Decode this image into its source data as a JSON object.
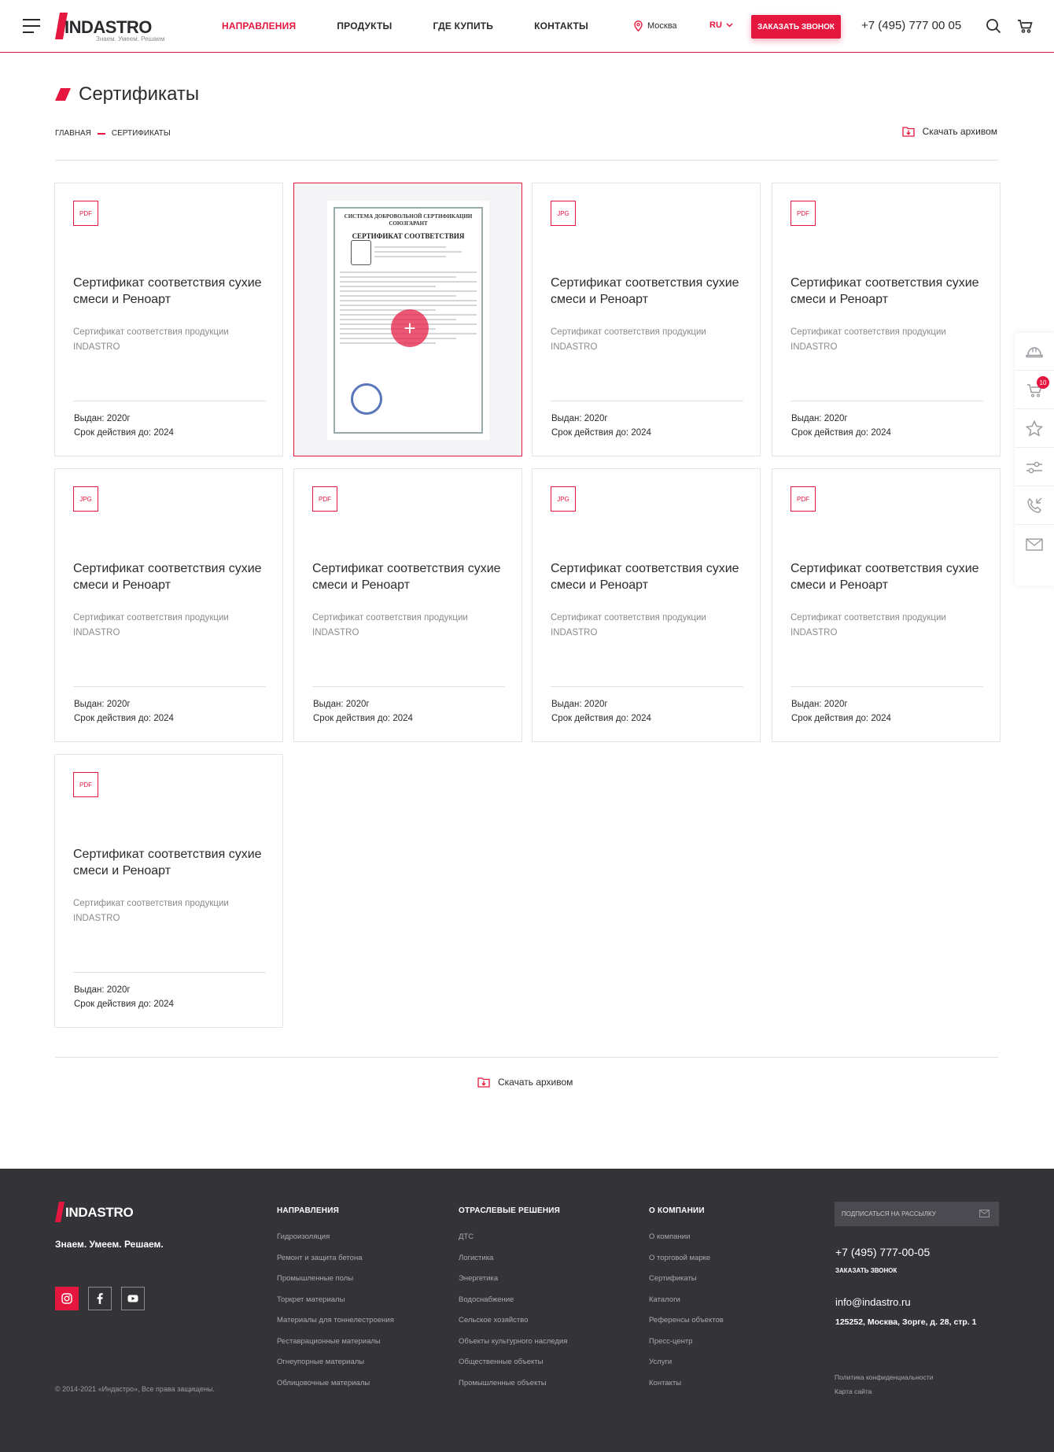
{
  "header": {
    "logo_text": "INDASTRO",
    "logo_tagline": "Знаем. Умеем. Решаем",
    "nav": [
      {
        "label": "Направления",
        "active": true
      },
      {
        "label": "Продукты",
        "active": false
      },
      {
        "label": "Где купить",
        "active": false
      },
      {
        "label": "Контакты",
        "active": false
      }
    ],
    "city": "Москва",
    "lang": "RU",
    "call_button": "Заказать звонок",
    "phone": "+7 (495) 777 00 05"
  },
  "page": {
    "title": "Сертификаты",
    "breadcrumb": [
      "Главная",
      "Сертификаты"
    ],
    "download_archive": "Скачать архивом"
  },
  "cards": [
    {
      "badge": "PDF",
      "title": "Сертификат соответствия сухие смеси и Реноарт",
      "desc": "Сертификат соответствия продукции INDASTRO",
      "issued": "Выдан: 2020г",
      "valid": "Срок действия до: 2024",
      "hover": false
    },
    {
      "badge": "",
      "title": "",
      "desc": "",
      "issued": "",
      "valid": "",
      "hover": true,
      "preview": {
        "head1": "СИСТЕМА ДОБРОВОЛЬНОЙ СЕРТИФИКАЦИИ",
        "head2": "СОЮЗГАРАНТ",
        "title": "СЕРТИФИКАТ СООТВЕТСТВИЯ"
      }
    },
    {
      "badge": "JPG",
      "title": "Сертификат соответствия сухие смеси и Реноарт",
      "desc": "Сертификат соответствия продукции INDASTRO",
      "issued": "Выдан: 2020г",
      "valid": "Срок действия до: 2024",
      "hover": false
    },
    {
      "badge": "PDF",
      "title": "Сертификат соответствия сухие смеси и Реноарт",
      "desc": "Сертификат соответствия продукции INDASTRO",
      "issued": "Выдан: 2020г",
      "valid": "Срок действия до: 2024",
      "hover": false
    },
    {
      "badge": "JPG",
      "title": "Сертификат соответствия сухие смеси и Реноарт",
      "desc": "Сертификат соответствия продукции INDASTRO",
      "issued": "Выдан: 2020г",
      "valid": "Срок действия до: 2024",
      "hover": false
    },
    {
      "badge": "PDF",
      "title": "Сертификат соответствия сухие смеси и Реноарт",
      "desc": "Сертификат соответствия продукции INDASTRO",
      "issued": "Выдан: 2020г",
      "valid": "Срок действия до: 2024",
      "hover": false
    },
    {
      "badge": "JPG",
      "title": "Сертификат соответствия сухие смеси и Реноарт",
      "desc": "Сертификат соответствия продукции INDASTRO",
      "issued": "Выдан: 2020г",
      "valid": "Срок действия до: 2024",
      "hover": false
    },
    {
      "badge": "PDF",
      "title": "Сертификат соответствия сухие смеси и Реноарт",
      "desc": "Сертификат соответствия продукции INDASTRO",
      "issued": "Выдан: 2020г",
      "valid": "Срок действия до: 2024",
      "hover": false
    },
    {
      "badge": "PDF",
      "title": "Сертификат соответствия сухие смеси и Реноарт",
      "desc": "Сертификат соответствия продукции INDASTRO",
      "issued": "Выдан: 2020г",
      "valid": "Срок действия до: 2024",
      "hover": false
    }
  ],
  "side_toolbar": {
    "items": [
      "helmet-icon",
      "cart-icon",
      "star-icon",
      "compare-icon",
      "phone-call-icon",
      "mail-icon"
    ],
    "cart_count": "10"
  },
  "footer": {
    "logo_text": "INDASTRO",
    "slogan": "Знаем. Умеем. Решаем.",
    "copyright": "© 2014-2021 «Индастро», Все права защищены.",
    "columns": [
      {
        "title": "Направления",
        "links": [
          "Гидроизоляция",
          "Ремонт и защита бетона",
          "Промышленные полы",
          "Торкрет материалы",
          "Материалы для тоннелестроения",
          "Реставрационные материалы",
          "Огнеупорные материалы",
          "Облицовочные материалы"
        ]
      },
      {
        "title": "Отраслевые решения",
        "links": [
          "ДТС",
          "Логистика",
          "Энергетика",
          "Водоснабжение",
          "Сельское хозяйство",
          "Объекты культурного наследия",
          "Общественные объекты",
          "Промышленные объекты"
        ]
      },
      {
        "title": "О компании",
        "links": [
          "О компании",
          "О торговой марке",
          "Сертификаты",
          "Каталоги",
          "Референсы объектов",
          "Пресс-центр",
          "Услуги",
          "Контакты"
        ]
      }
    ],
    "subscribe_placeholder": "Подписаться на рассылку",
    "phone": "+7 (495) 777-00-05",
    "call_link": "Заказать звонок",
    "email": "info@indastro.ru",
    "address": "125252, Москва, Зорге, д. 28, стр. 1",
    "policy": "Политика конфиденциальности",
    "sitemap": "Карта сайта"
  },
  "colors": {
    "accent": "#e5173f",
    "footer_bg": "#333338",
    "text": "#2b2b2f",
    "muted": "#8a8a8f"
  }
}
